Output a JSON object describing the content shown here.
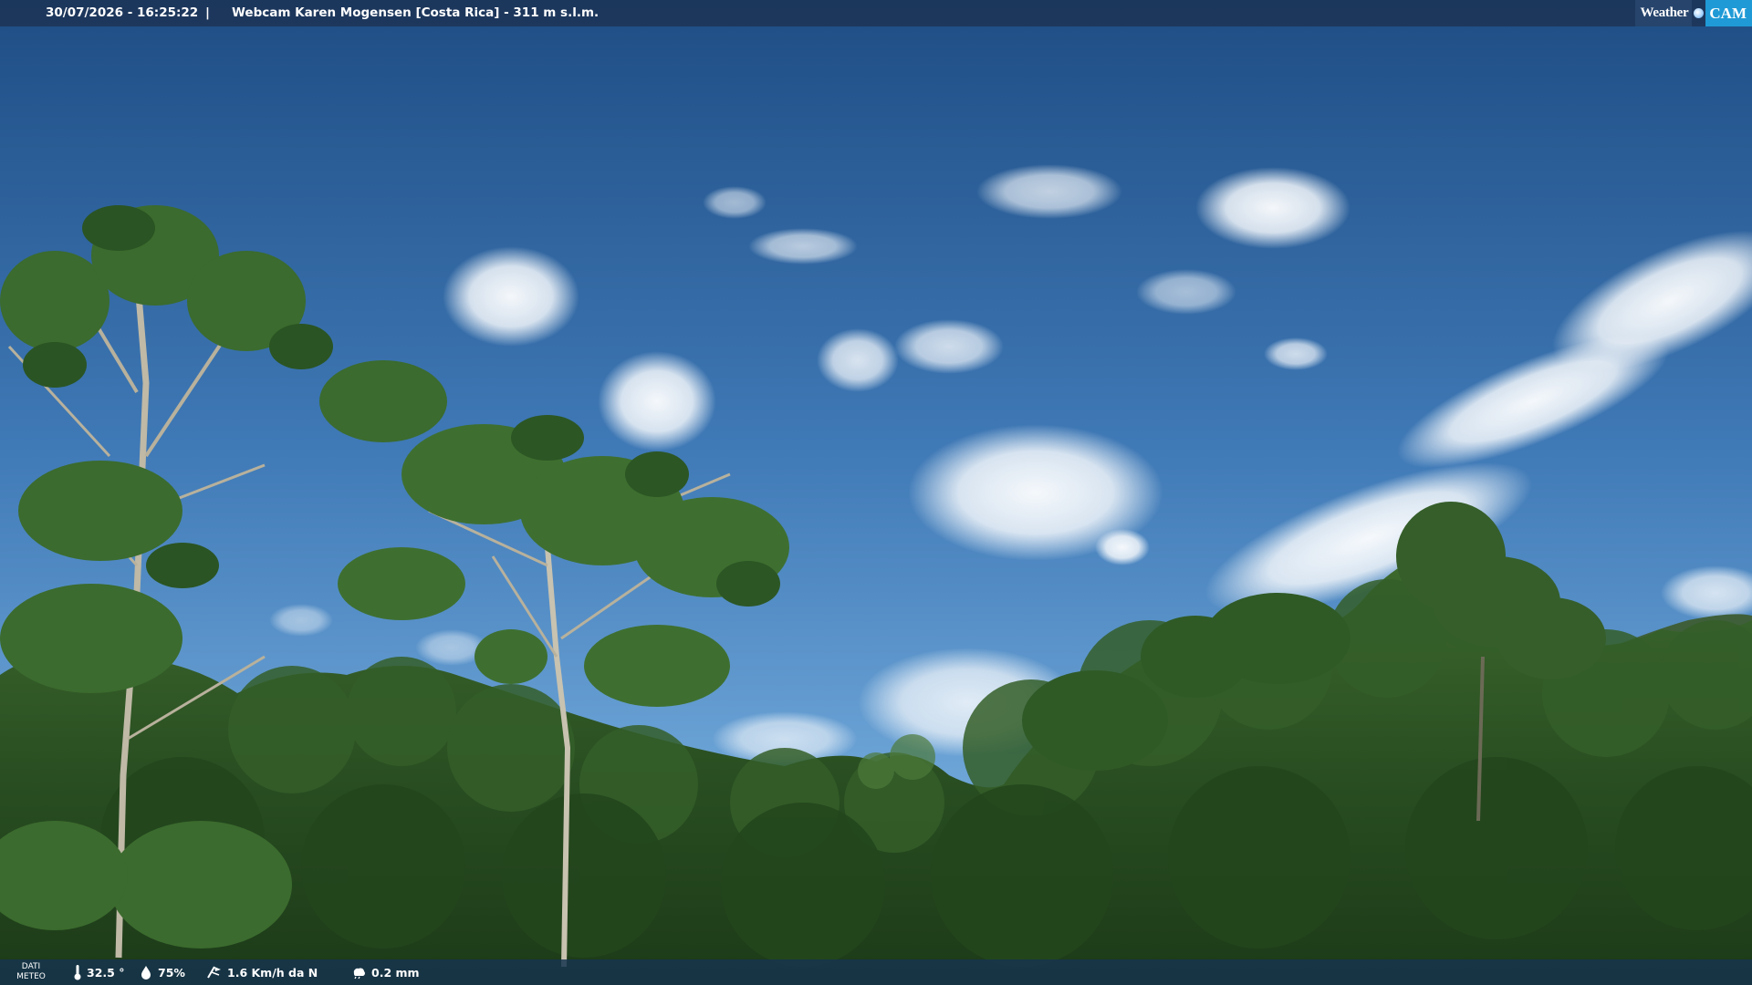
{
  "header": {
    "timestamp": "30/07/2026 - 16:25:22",
    "separator": "|",
    "title": "Webcam Karen Mogensen [Costa Rica]  - 311 m s.l.m."
  },
  "logo": {
    "weather_text": "Weather",
    "cam_text": "CAM",
    "icon": "globe-icon"
  },
  "footer": {
    "dati_line1": "DATI",
    "dati_line2": "METEO",
    "temperature": "32.5 °",
    "humidity": "75%",
    "wind": "1.6 Km/h da N",
    "rain": "0.2 mm",
    "icons": {
      "temperature": "thermometer-icon",
      "humidity": "humidity-drop-icon",
      "wind": "wind-icon",
      "rain": "rain-cloud-icon"
    }
  },
  "colors": {
    "sky_top": "#1f4f86",
    "sky_bottom": "#6ea6d8",
    "foliage": "#2f5a26",
    "bar": "#1c3456",
    "cam_accent": "#1f9ad6"
  }
}
